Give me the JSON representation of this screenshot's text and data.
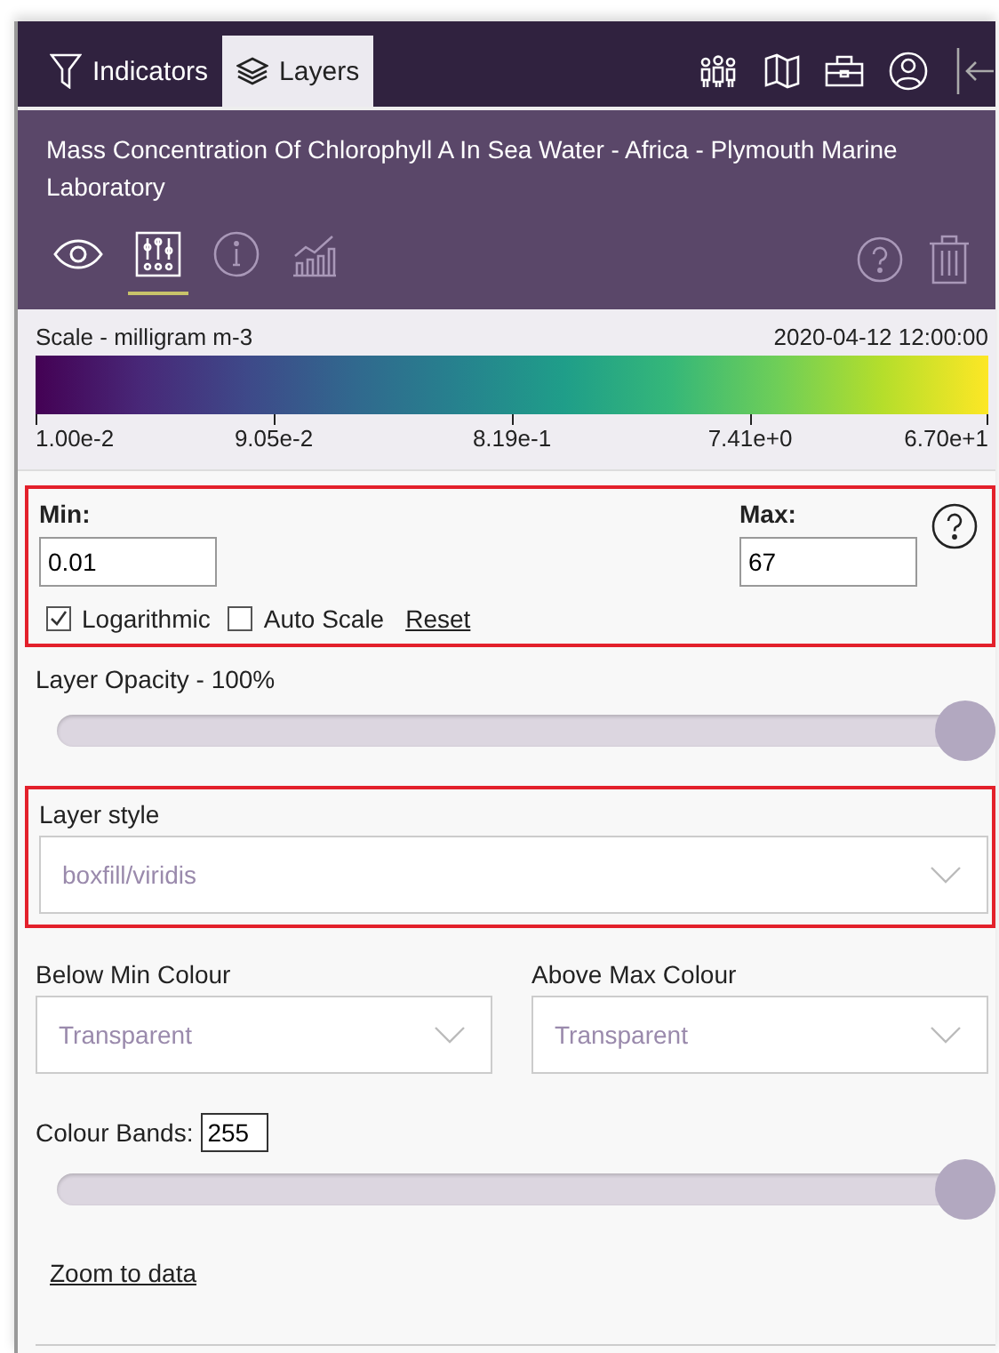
{
  "tabs": [
    {
      "label": "Indicators",
      "kind": "filter",
      "selected": false
    },
    {
      "label": "Layers",
      "kind": "layers",
      "selected": true
    }
  ],
  "toolbar_icons": [
    {
      "kind": "people"
    },
    {
      "kind": "map"
    },
    {
      "kind": "briefcase"
    },
    {
      "kind": "user"
    },
    {
      "kind": "collapse"
    }
  ],
  "layer": {
    "title": "Mass Concentration Of Chlorophyll A In Sea Water - Africa - Plymouth Marine Laboratory",
    "tools": [
      {
        "kind": "visibility",
        "selected": false
      },
      {
        "kind": "settings",
        "selected": true
      },
      {
        "kind": "info",
        "selected": false
      },
      {
        "kind": "chart",
        "selected": false
      }
    ],
    "actions": [
      {
        "kind": "help"
      },
      {
        "kind": "delete"
      }
    ]
  },
  "scale": {
    "label": "Scale - milligram m-3",
    "time": "2020-04-12 12:00:00",
    "ticks": [
      "1.00e-2",
      "9.05e-2",
      "8.19e-1",
      "7.41e+0",
      "6.70e+1"
    ]
  },
  "range": {
    "min_label": "Min:",
    "min_value": "0.01",
    "max_label": "Max:",
    "max_value": "67",
    "options": [
      {
        "label": "Logarithmic",
        "checked": true
      },
      {
        "label": "Auto Scale",
        "checked": false
      }
    ],
    "reset": "Reset"
  },
  "opacity": {
    "label": "Layer Opacity - 100%",
    "level": 1
  },
  "layer_style": {
    "label": "Layer style",
    "value": "boxfill/viridis"
  },
  "below_min": {
    "label": "Below Min Colour",
    "value": "Transparent"
  },
  "above_max": {
    "label": "Above Max Colour",
    "value": "Transparent"
  },
  "colour_bands": {
    "label": "Colour Bands:",
    "value": "255",
    "level": 1
  },
  "zoom_link": "Zoom to data"
}
